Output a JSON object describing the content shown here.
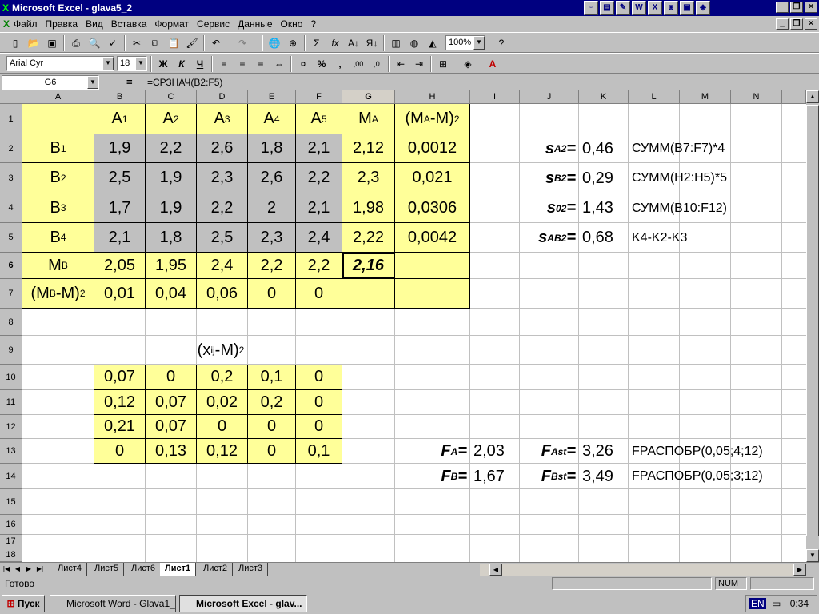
{
  "window": {
    "title": "Microsoft Excel - glava5_2"
  },
  "menu": [
    "Файл",
    "Правка",
    "Вид",
    "Вставка",
    "Формат",
    "Сервис",
    "Данные",
    "Окно",
    "?"
  ],
  "toolbar": {
    "zoom": "100%",
    "font": "Arial Cyr",
    "font_size": "18"
  },
  "formula_bar": {
    "name_box": "G6",
    "eq": "=",
    "formula": "=СРЗНАЧ(B2:F5)"
  },
  "columns": [
    "A",
    "B",
    "C",
    "D",
    "E",
    "F",
    "G",
    "H",
    "I",
    "J",
    "K",
    "L",
    "M",
    "N"
  ],
  "rows": [
    "1",
    "2",
    "3",
    "4",
    "5",
    "6",
    "7",
    "8",
    "9",
    "10",
    "11",
    "12",
    "13",
    "14",
    "15",
    "16",
    "17",
    "18"
  ],
  "cells": {
    "r1": {
      "b": "A",
      "c": "A",
      "d": "A",
      "e": "A",
      "f": "A",
      "g": "M",
      "h1": "(M",
      "h2": "-M)"
    },
    "r1sub": {
      "b": "1",
      "c": "2",
      "d": "3",
      "e": "4",
      "f": "5",
      "g": "A",
      "h": "A",
      "hsup": "2"
    },
    "r2": {
      "a": "B",
      "asub": "1",
      "b": "1,9",
      "c": "2,2",
      "d": "2,6",
      "e": "1,8",
      "f": "2,1",
      "g": "2,12",
      "h": "0,0012"
    },
    "r3": {
      "a": "B",
      "asub": "2",
      "b": "2,5",
      "c": "1,9",
      "d": "2,3",
      "e": "2,6",
      "f": "2,2",
      "g": "2,3",
      "h": "0,021"
    },
    "r4": {
      "a": "B",
      "asub": "3",
      "b": "1,7",
      "c": "1,9",
      "d": "2,2",
      "e": "2",
      "f": "2,1",
      "g": "1,98",
      "h": "0,0306"
    },
    "r5": {
      "a": "B",
      "asub": "4",
      "b": "2,1",
      "c": "1,8",
      "d": "2,5",
      "e": "2,3",
      "f": "2,4",
      "g": "2,22",
      "h": "0,0042"
    },
    "r6": {
      "a": "M",
      "asub": "B",
      "b": "2,05",
      "c": "1,95",
      "d": "2,4",
      "e": "2,2",
      "f": "2,2",
      "g": "2,16"
    },
    "r7": {
      "a1": "(M",
      "asub": "B",
      "a2": "-M)",
      "asup": "2",
      "b": "0,01",
      "c": "0,04",
      "d": "0,06",
      "e": "0",
      "f": "0"
    },
    "r9": {
      "t1": "(x",
      "tsub": "ij",
      "t2": "-M)",
      "tsup": "2"
    },
    "r10": {
      "b": "0,07",
      "c": "0",
      "d": "0,2",
      "e": "0,1",
      "f": "0"
    },
    "r11": {
      "b": "0,12",
      "c": "0,07",
      "d": "0,02",
      "e": "0,2",
      "f": "0"
    },
    "r12": {
      "b": "0,21",
      "c": "0,07",
      "d": "0",
      "e": "0",
      "f": "0"
    },
    "r13": {
      "b": "0",
      "c": "0,13",
      "d": "0,12",
      "e": "0",
      "f": "0,1"
    },
    "stats": [
      {
        "sym": "s",
        "sub": "A",
        "sup": "2",
        "eq": "=",
        "val": "0,46",
        "formula": "СУММ(B7:F7)*4"
      },
      {
        "sym": "s",
        "sub": "B",
        "sup": "2",
        "eq": "=",
        "val": "0,29",
        "formula": "СУММ(H2:H5)*5"
      },
      {
        "sym": "s",
        "sub": "0",
        "sup": "2",
        "eq": "=",
        "val": "1,43",
        "formula": "СУММ(B10:F12)"
      },
      {
        "sym": "s",
        "sub": "AB",
        "sup": "2",
        "eq": "=",
        "val": "0,68",
        "formula": "K4-K2-K3"
      }
    ],
    "ftests": [
      {
        "sym": "F",
        "sub": "A",
        "eq": "=",
        "val": "2,03",
        "sym2": "F",
        "sub2": "Ast",
        "eq2": "=",
        "val2": "3,26",
        "formula": "FРАСПОБР(0,05;4;12)"
      },
      {
        "sym": "F",
        "sub": "B",
        "eq": "=",
        "val": "1,67",
        "sym2": "F",
        "sub2": "Bst",
        "eq2": "=",
        "val2": "3,49",
        "formula": "FРАСПОБР(0,05;3;12)"
      }
    ]
  },
  "sheet_tabs": [
    "Лист4",
    "Лист5",
    "Лист6",
    "Лист1",
    "Лист2",
    "Лист3"
  ],
  "status": {
    "ready": "Готово",
    "num": "NUM"
  },
  "taskbar": {
    "start": "Пуск",
    "tasks": [
      "Microsoft Word - Glava1_5",
      "Microsoft Excel - glav..."
    ],
    "lang": "EN",
    "clock": "0:34"
  }
}
